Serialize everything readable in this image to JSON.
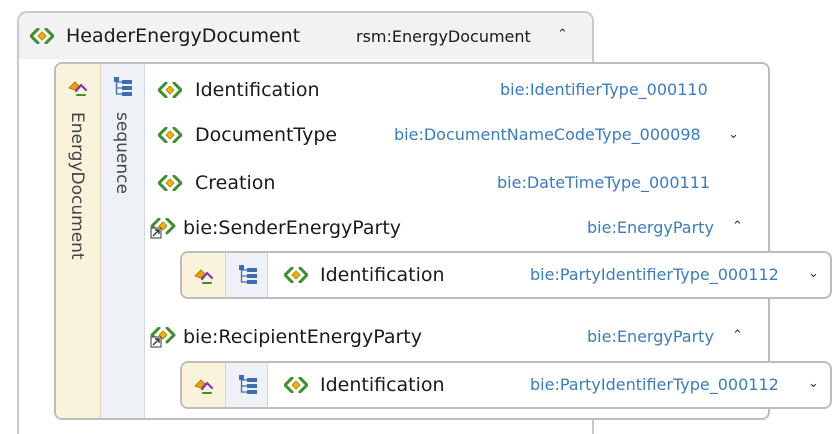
{
  "root": {
    "name": "HeaderEnergyDocument",
    "type": "rsm:EnergyDocument"
  },
  "complex_type": {
    "name": "EnergyDocument",
    "compositor": "sequence",
    "children": [
      {
        "name": "Identification",
        "type": "bie:IdentifierType_000110",
        "icon": "element-icon"
      },
      {
        "name": "DocumentType",
        "type": "bie:DocumentNameCodeType_000098",
        "icon": "element-icon",
        "toggle": "expand"
      },
      {
        "name": "Creation",
        "type": "bie:DateTimeType_000111",
        "icon": "element-icon"
      },
      {
        "name": "bie:SenderEnergyParty",
        "type": "bie:EnergyParty",
        "icon": "element-reference-icon",
        "toggle": "collapse",
        "nested": {
          "name": "Identification",
          "type": "bie:PartyIdentifierType_000112"
        }
      },
      {
        "name": "bie:RecipientEnergyParty",
        "type": "bie:EnergyParty",
        "icon": "element-reference-icon",
        "toggle": "collapse",
        "nested": {
          "name": "Identification",
          "type": "bie:PartyIdentifierType_000112"
        }
      }
    ]
  },
  "colors": {
    "type_text": "#3a7cc0",
    "element_icon": "#3c8f2a",
    "complex_type_strip": "#faf3dc",
    "sequence_strip": "#eef1f5",
    "border": "#bdbdbd"
  }
}
